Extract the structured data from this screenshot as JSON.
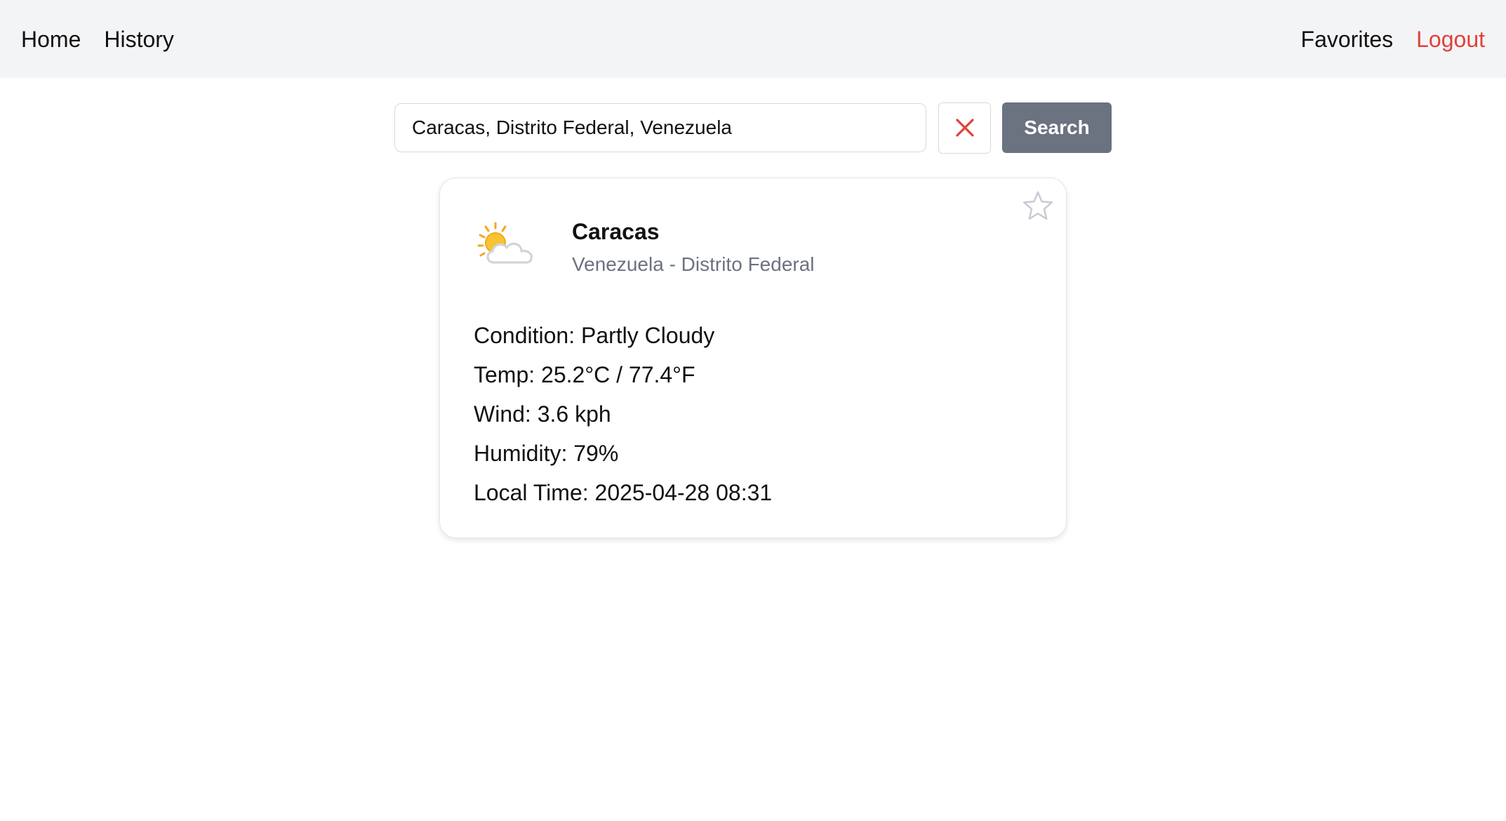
{
  "nav": {
    "home": "Home",
    "history": "History",
    "favorites": "Favorites",
    "logout": "Logout"
  },
  "search": {
    "value": "Caracas, Distrito Federal, Venezuela",
    "clear_icon": "close-icon",
    "button_label": "Search"
  },
  "weather": {
    "icon": "partly-cloudy-icon",
    "favorite_icon": "star-outline-icon",
    "city": "Caracas",
    "region": "Venezuela - Distrito Federal",
    "condition": "Condition: Partly Cloudy",
    "temp": "Temp: 25.2°C / 77.4°F",
    "wind": "Wind: 3.6 kph",
    "humidity": "Humidity: 79%",
    "local_time": "Local Time: 2025-04-28 08:31"
  },
  "colors": {
    "nav_background": "#f3f4f6",
    "logout": "#e0413a",
    "clear_icon": "#e0413a",
    "search_button": "#6b7280",
    "region_text": "#6b7280",
    "star_outline": "#c9ccd3"
  }
}
